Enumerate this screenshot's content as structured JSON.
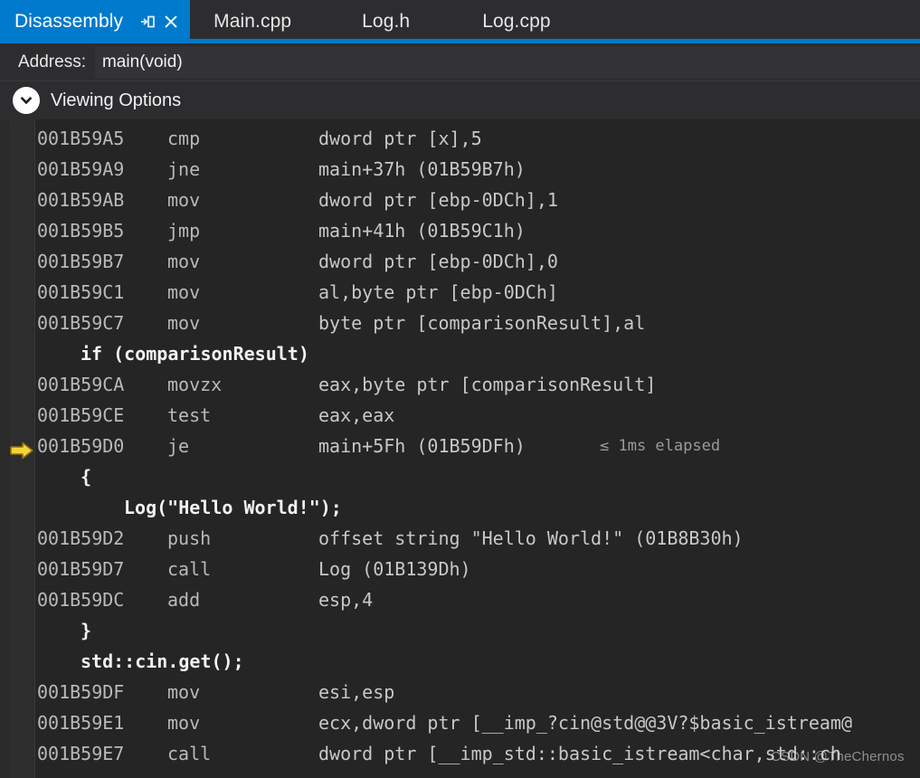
{
  "window": {
    "title": "Disassembly",
    "accent_color": "#007acc",
    "background_color": "#2d2d30",
    "code_background_color": "#252526"
  },
  "tabs": [
    {
      "label": "Disassembly",
      "active": true
    },
    {
      "label": "Main.cpp",
      "active": false
    },
    {
      "label": "Log.h",
      "active": false
    },
    {
      "label": "Log.cpp",
      "active": false
    }
  ],
  "tab_icons": {
    "pin": "pin-icon",
    "close": "close-icon"
  },
  "address_bar": {
    "label": "Address:",
    "value": "main(void)",
    "placeholder": "Address"
  },
  "viewing_options": {
    "label": "Viewing Options",
    "icon": "chevron-down-icon",
    "expanded": false
  },
  "current_instruction": {
    "address": "001B59D0",
    "marker_color": "#f6d33c",
    "marker": "current-instruction-arrow"
  },
  "code_lines": [
    {
      "type": "asm",
      "address": "001B59A5",
      "mnemonic": "cmp",
      "operands": "dword ptr [x],5"
    },
    {
      "type": "asm",
      "address": "001B59A9",
      "mnemonic": "jne",
      "operands": "main+37h (01B59B7h)"
    },
    {
      "type": "asm",
      "address": "001B59AB",
      "mnemonic": "mov",
      "operands": "dword ptr [ebp-0DCh],1"
    },
    {
      "type": "asm",
      "address": "001B59B5",
      "mnemonic": "jmp",
      "operands": "main+41h (01B59C1h)"
    },
    {
      "type": "asm",
      "address": "001B59B7",
      "mnemonic": "mov",
      "operands": "dword ptr [ebp-0DCh],0"
    },
    {
      "type": "asm",
      "address": "001B59C1",
      "mnemonic": "mov",
      "operands": "al,byte ptr [ebp-0DCh]"
    },
    {
      "type": "asm",
      "address": "001B59C7",
      "mnemonic": "mov",
      "operands": "byte ptr [comparisonResult],al"
    },
    {
      "type": "source",
      "text": "if (comparisonResult)",
      "indent": 4
    },
    {
      "type": "asm",
      "address": "001B59CA",
      "mnemonic": "movzx",
      "operands": "eax,byte ptr [comparisonResult]"
    },
    {
      "type": "asm",
      "address": "001B59CE",
      "mnemonic": "test",
      "operands": "eax,eax"
    },
    {
      "type": "asm",
      "address": "001B59D0",
      "mnemonic": "je",
      "operands": "main+5Fh (01B59DFh)",
      "elapsed": "≤ 1ms elapsed",
      "current": true
    },
    {
      "type": "source",
      "text": "{",
      "indent": 4
    },
    {
      "type": "source",
      "text": "Log(\"Hello World!\");",
      "indent": 8
    },
    {
      "type": "asm",
      "address": "001B59D2",
      "mnemonic": "push",
      "operands": "offset string \"Hello World!\" (01B8B30h)"
    },
    {
      "type": "asm",
      "address": "001B59D7",
      "mnemonic": "call",
      "operands": "Log (01B139Dh)"
    },
    {
      "type": "asm",
      "address": "001B59DC",
      "mnemonic": "add",
      "operands": "esp,4"
    },
    {
      "type": "source",
      "text": "}",
      "indent": 4
    },
    {
      "type": "source",
      "text": "std::cin.get();",
      "indent": 4
    },
    {
      "type": "asm",
      "address": "001B59DF",
      "mnemonic": "mov",
      "operands": "esi,esp"
    },
    {
      "type": "asm",
      "address": "001B59E1",
      "mnemonic": "mov",
      "operands": "ecx,dword ptr [__imp_?cin@std@@3V?$basic_istream@"
    },
    {
      "type": "asm",
      "address": "001B59E7",
      "mnemonic": "call",
      "operands": "dword ptr [__imp_std::basic_istream<char,std::ch"
    }
  ],
  "watermark": "CSDN @TheChernos"
}
